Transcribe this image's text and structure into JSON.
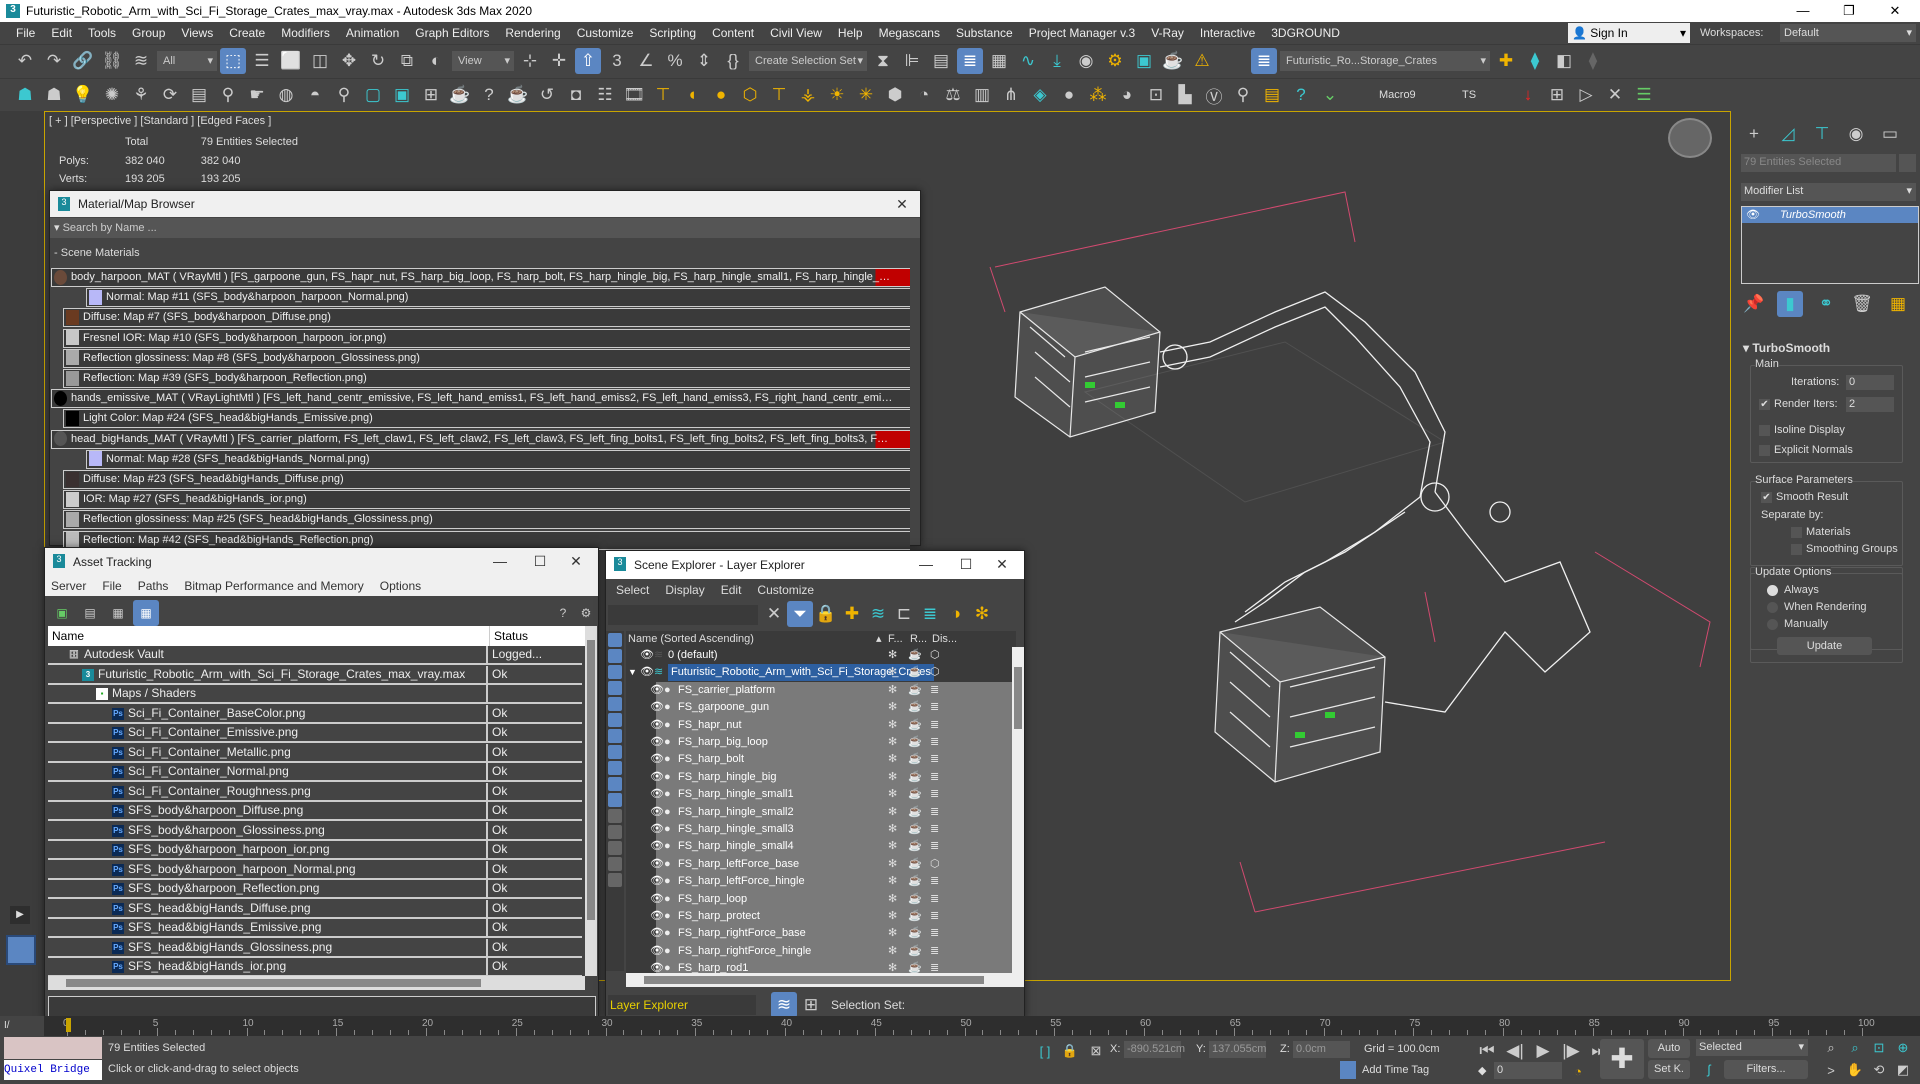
{
  "window": {
    "title": "Futuristic_Robotic_Arm_with_Sci_Fi_Storage_Crates_max_vray.max - Autodesk 3ds Max 2020",
    "minimize": "—",
    "maximize": "❐",
    "close": "✕"
  },
  "menubar": {
    "items": [
      "File",
      "Edit",
      "Tools",
      "Group",
      "Views",
      "Create",
      "Modifiers",
      "Animation",
      "Graph Editors",
      "Rendering",
      "Customize",
      "Scripting",
      "Content",
      "Civil View",
      "Help",
      "Megascans",
      "Substance",
      "Project Manager v.3",
      "V-Ray",
      "Interactive",
      "3DGROUND"
    ],
    "sign_in": "Sign In",
    "workspaces_label": "Workspaces:",
    "workspace": "Default"
  },
  "toolbar1": {
    "filter": "All",
    "ref_coord": "View",
    "selection_set": "Create Selection Set",
    "layer": "Futuristic_Ro...Storage_Crates"
  },
  "toolbar2": {
    "macro": "Macro9",
    "ts": "TS"
  },
  "viewport": {
    "label": "[ + ] [Perspective ] [Standard ] [Edged Faces ]",
    "stats": {
      "col_total": "Total",
      "col_selected": "79 Entities Selected",
      "polys_label": "Polys:",
      "polys_total": "382 040",
      "polys_sel": "382 040",
      "verts_label": "Verts:",
      "verts_total": "193 205",
      "verts_sel": "193 205"
    }
  },
  "command_panel": {
    "selection": "79 Entities Selected",
    "modifier_list": "Modifier List",
    "stack": [
      "TurboSmooth"
    ],
    "rollout": "TurboSmooth",
    "main": "Main",
    "iterations_label": "Iterations:",
    "iterations": "0",
    "render_iters_label": "Render Iters:",
    "render_iters": "2",
    "render_iters_checked": true,
    "isoline": "Isoline Display",
    "explicit_normals": "Explicit Normals",
    "surface": "Surface Parameters",
    "smooth_result": "Smooth Result",
    "separate_by": "Separate by:",
    "materials": "Materials",
    "smoothing_groups": "Smoothing Groups",
    "update_options": "Update Options",
    "always": "Always",
    "when_rendering": "When Rendering",
    "manually": "Manually",
    "update_button": "Update",
    "update_selected": "Always"
  },
  "material_browser": {
    "title": "Material/Map Browser",
    "search_placeholder": "Search by Name ...",
    "section": "Scene Materials",
    "rows": [
      {
        "level": 0,
        "text": "body_harpoon_MAT  ( VRayMtl )  [FS_garpoone_gun, FS_hapr_nut, FS_harp_big_loop, FS_harp_bolt, FS_harp_hingle_big, FS_harp_hingle_small1, FS_harp_hingle_sma...",
        "swatch": "#6a4a3a",
        "flag": true
      },
      {
        "level": 2,
        "text": "Normal: Map #11 (SFS_body&harpoon_harpoon_Normal.png)",
        "swatch": "#b8b8f8"
      },
      {
        "level": 1,
        "text": "Diffuse: Map #7 (SFS_body&harpoon_Diffuse.png)",
        "swatch": "#6a3a20"
      },
      {
        "level": 1,
        "text": "Fresnel IOR: Map #10 (SFS_body&harpoon_harpoon_ior.png)",
        "swatch": "#c8c8c8"
      },
      {
        "level": 1,
        "text": "Reflection glossiness: Map #8 (SFS_body&harpoon_Glossiness.png)",
        "swatch": "#aaaaaa"
      },
      {
        "level": 1,
        "text": "Reflection: Map #39 (SFS_body&harpoon_Reflection.png)",
        "swatch": "#999999"
      },
      {
        "level": 0,
        "text": "hands_emissive_MAT  ( VRayLightMtl )  [FS_left_hand_centr_emissive, FS_left_hand_emiss1, FS_left_hand_emiss2, FS_left_hand_emiss3, FS_right_hand_centr_emissiv...",
        "swatch": "#000000"
      },
      {
        "level": 1,
        "text": "Light Color: Map #24 (SFS_head&bigHands_Emissive.png)",
        "swatch": "#000000"
      },
      {
        "level": 0,
        "text": "head_bigHands_MAT  ( VRayMtl )  [FS_carrier_platform, FS_left_claw1, FS_left_claw2, FS_left_claw3, FS_left_fing_bolts1, FS_left_fing_bolts2, FS_left_fing_bolts3, FS_...",
        "swatch": "#555555",
        "flag": true
      },
      {
        "level": 2,
        "text": "Normal: Map #28 (SFS_head&bigHands_Normal.png)",
        "swatch": "#b8b8f8"
      },
      {
        "level": 1,
        "text": "Diffuse: Map #23 (SFS_head&bigHands_Diffuse.png)",
        "swatch": "#3a3030"
      },
      {
        "level": 1,
        "text": "IOR: Map #27 (SFS_head&bigHands_ior.png)",
        "swatch": "#cccccc"
      },
      {
        "level": 1,
        "text": "Reflection glossiness: Map #25 (SFS_head&bigHands_Glossiness.png)",
        "swatch": "#aaaaaa"
      },
      {
        "level": 1,
        "text": "Reflection: Map #42 (SFS_head&bigHands_Reflection.png)",
        "swatch": "#bbbbbb"
      }
    ]
  },
  "asset_tracking": {
    "title": "Asset Tracking",
    "menu": [
      "Server",
      "File",
      "Paths",
      "Bitmap Performance and Memory",
      "Options"
    ],
    "columns": [
      "Name",
      "Status"
    ],
    "rows": [
      {
        "level": 0,
        "icon": "vault",
        "name": "Autodesk Vault",
        "status": "Logged..."
      },
      {
        "level": 1,
        "icon": "max",
        "name": "Futuristic_Robotic_Arm_with_Sci_Fi_Storage_Crates_max_vray.max",
        "status": "Ok"
      },
      {
        "level": 2,
        "icon": "folder",
        "name": "Maps / Shaders",
        "status": ""
      },
      {
        "level": 3,
        "icon": "ps",
        "name": "Sci_Fi_Container_BaseColor.png",
        "status": "Ok"
      },
      {
        "level": 3,
        "icon": "ps",
        "name": "Sci_Fi_Container_Emissive.png",
        "status": "Ok"
      },
      {
        "level": 3,
        "icon": "ps",
        "name": "Sci_Fi_Container_Metallic.png",
        "status": "Ok"
      },
      {
        "level": 3,
        "icon": "ps",
        "name": "Sci_Fi_Container_Normal.png",
        "status": "Ok"
      },
      {
        "level": 3,
        "icon": "ps",
        "name": "Sci_Fi_Container_Roughness.png",
        "status": "Ok"
      },
      {
        "level": 3,
        "icon": "ps",
        "name": "SFS_body&harpoon_Diffuse.png",
        "status": "Ok"
      },
      {
        "level": 3,
        "icon": "ps",
        "name": "SFS_body&harpoon_Glossiness.png",
        "status": "Ok"
      },
      {
        "level": 3,
        "icon": "ps",
        "name": "SFS_body&harpoon_harpoon_ior.png",
        "status": "Ok"
      },
      {
        "level": 3,
        "icon": "ps",
        "name": "SFS_body&harpoon_harpoon_Normal.png",
        "status": "Ok"
      },
      {
        "level": 3,
        "icon": "ps",
        "name": "SFS_body&harpoon_Reflection.png",
        "status": "Ok"
      },
      {
        "level": 3,
        "icon": "ps",
        "name": "SFS_head&bigHands_Diffuse.png",
        "status": "Ok"
      },
      {
        "level": 3,
        "icon": "ps",
        "name": "SFS_head&bigHands_Emissive.png",
        "status": "Ok"
      },
      {
        "level": 3,
        "icon": "ps",
        "name": "SFS_head&bigHands_Glossiness.png",
        "status": "Ok"
      },
      {
        "level": 3,
        "icon": "ps",
        "name": "SFS_head&bigHands_ior.png",
        "status": "Ok"
      }
    ]
  },
  "scene_explorer": {
    "title": "Scene Explorer - Layer Explorer",
    "menu": [
      "Select",
      "Display",
      "Edit",
      "Customize"
    ],
    "columns": [
      "Name (Sorted Ascending)",
      "F...",
      "R...",
      "Dis..."
    ],
    "layers": [
      {
        "name": "0 (default)",
        "level": 0
      },
      {
        "name": "Futuristic_Robotic_Arm_with_Sci_Fi_Storage_Crates",
        "level": 0,
        "selected": true,
        "expanded": true
      }
    ],
    "objects": [
      "FS_carrier_platform",
      "FS_garpoone_gun",
      "FS_hapr_nut",
      "FS_harp_big_loop",
      "FS_harp_bolt",
      "FS_harp_hingle_big",
      "FS_harp_hingle_small1",
      "FS_harp_hingle_small2",
      "FS_harp_hingle_small3",
      "FS_harp_hingle_small4",
      "FS_harp_leftForce_base",
      "FS_harp_leftForce_hingle",
      "FS_harp_loop",
      "FS_harp_protect",
      "FS_harp_rightForce_base",
      "FS_harp_rightForce_hingle",
      "FS_harp_rod1"
    ],
    "footer_mode": "Layer Explorer",
    "selection_set_label": "Selection Set:"
  },
  "timeline": {
    "ticks": [
      "0",
      "5",
      "10",
      "15",
      "20",
      "25",
      "30",
      "35",
      "40",
      "45",
      "50",
      "55",
      "60",
      "65",
      "70",
      "75",
      "80",
      "85",
      "90",
      "95",
      "100"
    ],
    "current_frame": 0,
    "range_end": 100
  },
  "status": {
    "selection": "79 Entities Selected",
    "prompt": "Click or click-and-drag to select objects",
    "x_label": "X:",
    "x": "-890.521cm",
    "y_label": "Y:",
    "y": "137.055cm",
    "z_label": "Z:",
    "z": "0.0cm",
    "grid": "Grid = 100.0cm",
    "add_time_tag": "Add Time Tag",
    "frame": "0",
    "auto": "Auto",
    "set_key": "Set K.",
    "key_filter": "Selected",
    "filters": "Filters...",
    "quixel": "Quixel Bridge"
  },
  "colors": {
    "accent": "#5b86c2",
    "viewport_border": "#c8a400",
    "selection_highlight": "#2d5fa0",
    "flag_red": "#c00000"
  }
}
